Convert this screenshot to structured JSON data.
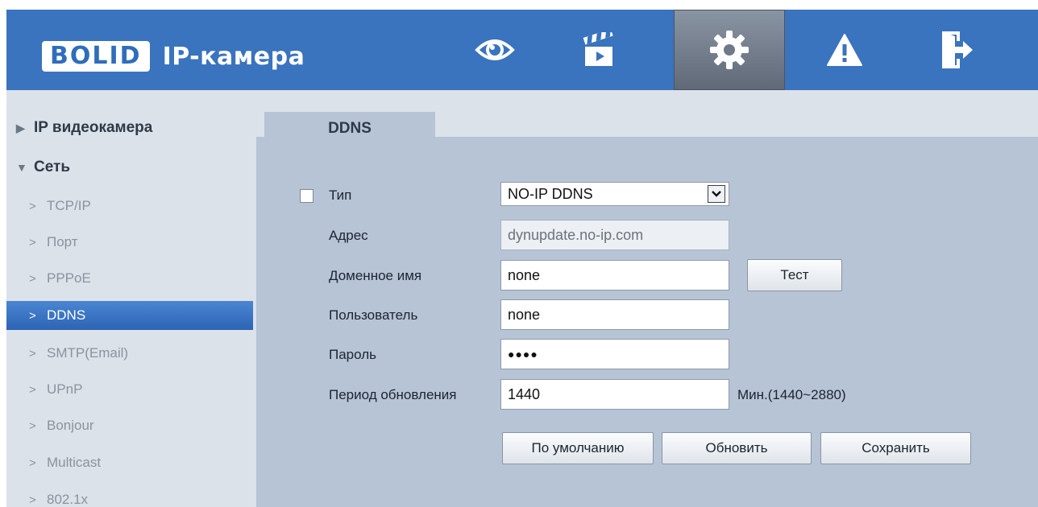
{
  "header": {
    "logo_text": "BOLID",
    "app_title": "IP-камера",
    "nav_icons": [
      "eye-icon",
      "clapperboard-icon",
      "gear-icon",
      "warning-icon",
      "exit-icon"
    ],
    "active_nav": "gear-icon"
  },
  "sidebar": {
    "groups": [
      {
        "label": "IP видеокамера",
        "expanded": false
      },
      {
        "label": "Сеть",
        "expanded": true
      }
    ],
    "items": [
      {
        "label": "TCP/IP"
      },
      {
        "label": "Порт"
      },
      {
        "label": "PPPoE"
      },
      {
        "label": "DDNS",
        "active": true
      },
      {
        "label": "SMTP(Email)"
      },
      {
        "label": "UPnP"
      },
      {
        "label": "Bonjour"
      },
      {
        "label": "Multicast"
      },
      {
        "label": "802.1x"
      }
    ]
  },
  "tab": {
    "label": "DDNS"
  },
  "form": {
    "type_label": "Тип",
    "type_enabled": false,
    "type_value": "NO-IP DDNS",
    "address_label": "Адрес",
    "address_value": "dynupdate.no-ip.com",
    "domain_label": "Доменное имя",
    "domain_value": "none",
    "test_button": "Тест",
    "user_label": "Пользователь",
    "user_value": "none",
    "password_label": "Пароль",
    "password_value": "●●●●",
    "period_label": "Период обновления",
    "period_value": "1440",
    "period_hint": "Мин.(1440~2880)"
  },
  "buttons": {
    "default": "По умолчанию",
    "refresh": "Обновить",
    "save": "Сохранить"
  },
  "colors": {
    "header": "#3a73be",
    "active_item": "#2d64b5",
    "panel": "#b6c4d6"
  }
}
